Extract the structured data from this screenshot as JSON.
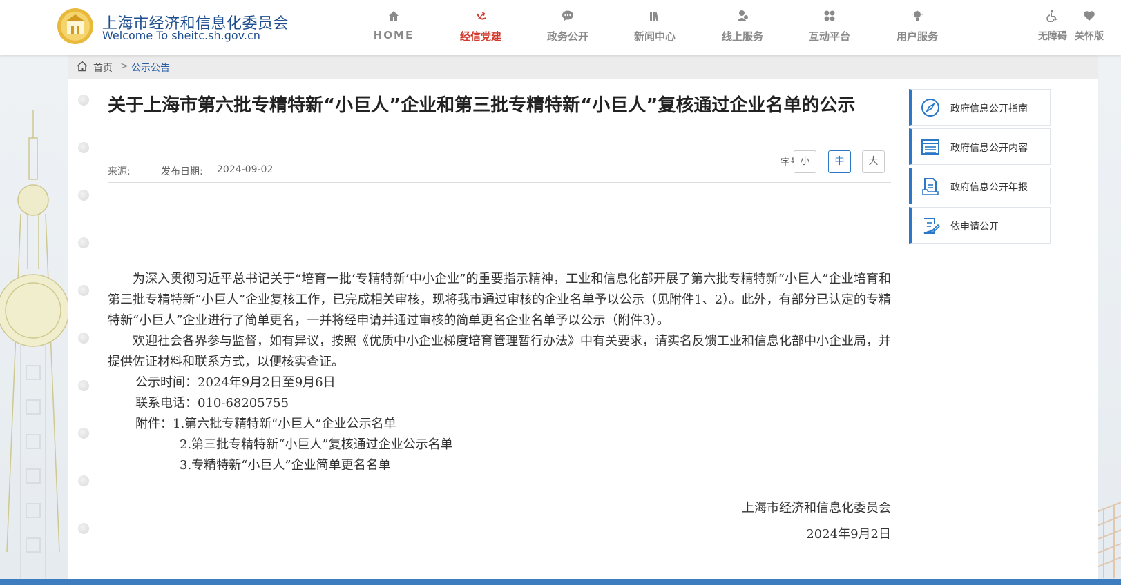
{
  "header": {
    "logo_cn": "上海市经济和信息化委员会",
    "logo_en": "Welcome To sheitc.sh.gov.cn",
    "nav": [
      {
        "label": "HOME",
        "icon": "home-icon"
      },
      {
        "label": "经信党建",
        "icon": "party-emblem-icon"
      },
      {
        "label": "政务公开",
        "icon": "chat-bubble-icon"
      },
      {
        "label": "新闻中心",
        "icon": "books-icon"
      },
      {
        "label": "线上服务",
        "icon": "user-service-icon"
      },
      {
        "label": "互动平台",
        "icon": "interact-icon"
      },
      {
        "label": "用户服务",
        "icon": "bulb-icon"
      }
    ],
    "accessibility": [
      {
        "label": "无障碍",
        "icon": "wheelchair-icon"
      },
      {
        "label": "关怀版",
        "icon": "heart-icon"
      }
    ],
    "active_color": "#d23a2e"
  },
  "breadcrumb": {
    "home": "首页",
    "separator": ">",
    "current": "公示公告"
  },
  "article": {
    "title": "关于上海市第六批专精特新“小巨人”企业和第三批专精特新“小巨人”复核通过企业名单的公示",
    "source_label": "来源:",
    "date_label": "发布日期:",
    "date": "2024-09-02",
    "fontsize_label": "字号:",
    "fontsize_small": "小",
    "fontsize_medium": "中",
    "fontsize_large": "大",
    "para1": "为深入贯彻习近平总书记关于“培育一批‘专精特新’中小企业”的重要指示精神，工业和信息化部开展了第六批专精特新“小巨人”企业培育和第三批专精特新“小巨人”企业复核工作，已完成相关审核，现将我市通过审核的企业名单予以公示（见附件1、2）。此外，有部分已认定的专精特新“小巨人”企业进行了简单更名，一并将经申请并通过审核的简单更名企业名单予以公示（附件3）。",
    "para2": "欢迎社会各界参与监督，如有异议，按照《优质中小企业梯度培育管理暂行办法》中有关要求，请实名反馈工业和信息化部中小企业局，并提供佐证材料和联系方式，以便核实查证。",
    "period": "公示时间：2024年9月2日至9月6日",
    "phone": "联系电话：010-68205755",
    "attach1": "附件：1.第六批专精特新“小巨人”企业公示名单",
    "attach2": "2.第三批专精特新“小巨人”复核通过企业公示名单",
    "attach3": "3.专精特新“小巨人”企业简单更名名单",
    "signature": "上海市经济和信息化委员会",
    "sign_date": "2024年9月2日"
  },
  "sidebar": {
    "items": [
      {
        "label": "政府信息公开指南",
        "icon": "compass-icon"
      },
      {
        "label": "政府信息公开内容",
        "icon": "list-icon"
      },
      {
        "label": "政府信息公开年报",
        "icon": "report-icon"
      },
      {
        "label": "依申请公开",
        "icon": "apply-form-icon"
      }
    ],
    "accent_color": "#2a78c7"
  }
}
